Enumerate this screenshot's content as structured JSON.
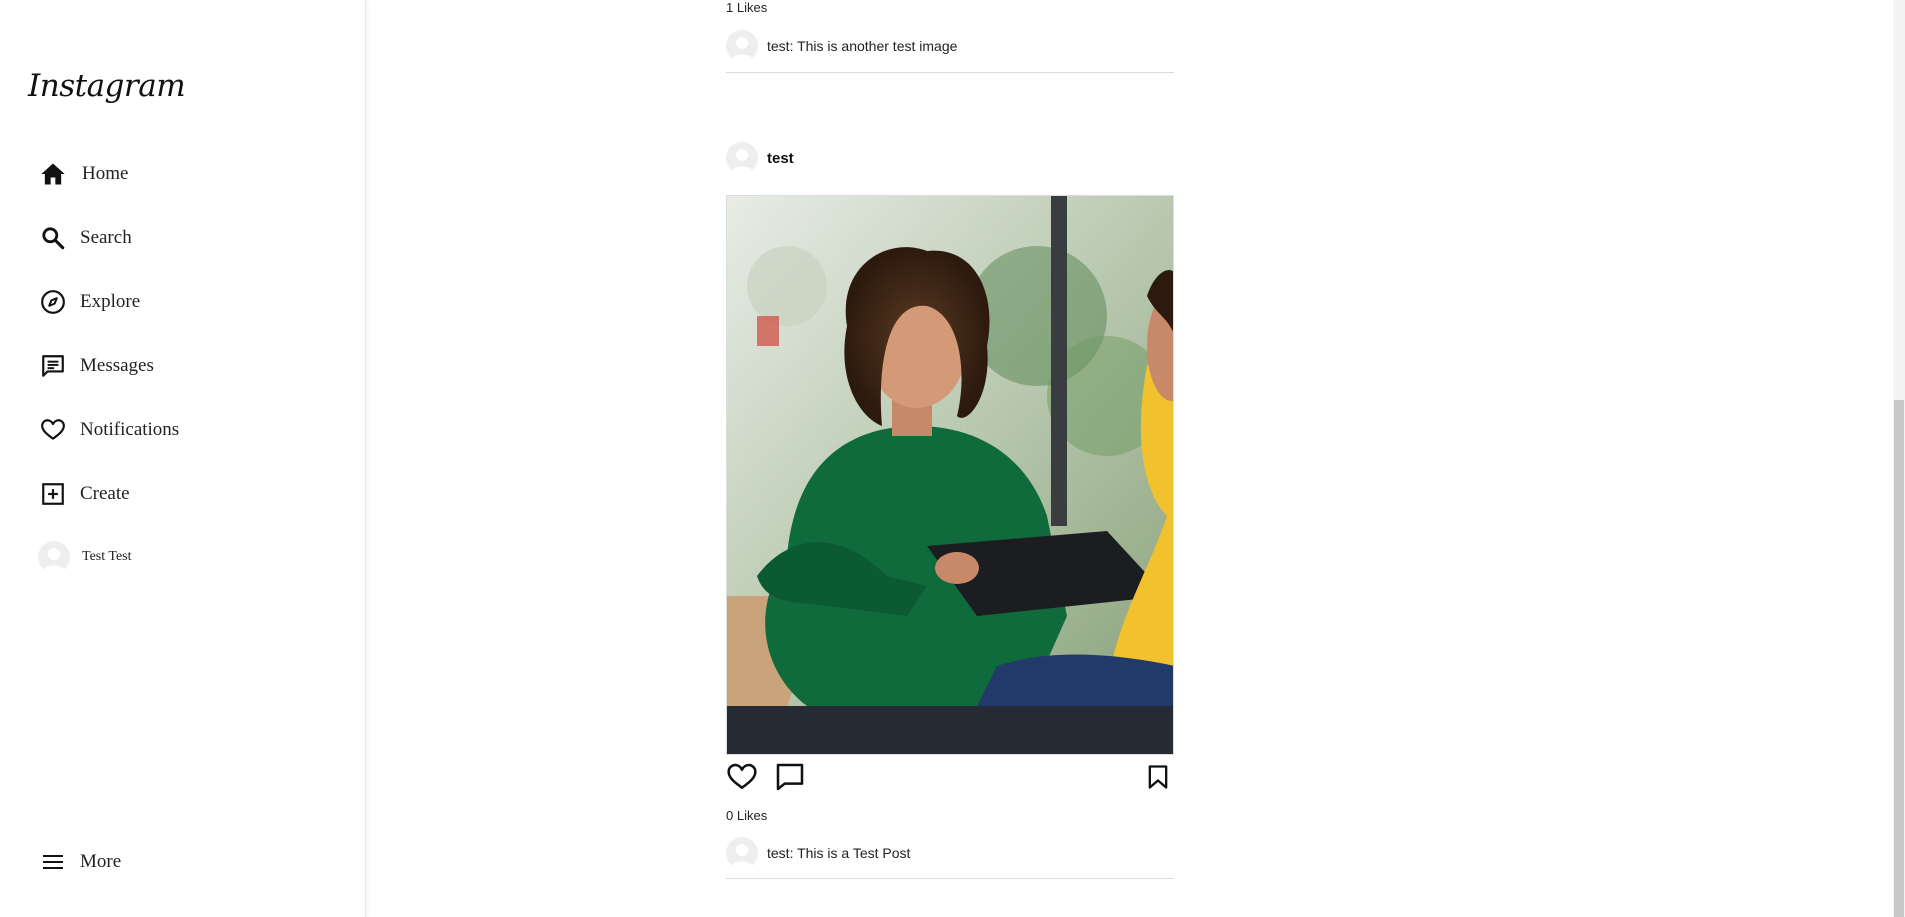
{
  "app": {
    "logo": "Instagram"
  },
  "sidebar": {
    "items": [
      {
        "label": "Home",
        "icon": "home-icon"
      },
      {
        "label": "Search",
        "icon": "search-icon"
      },
      {
        "label": "Explore",
        "icon": "compass-icon"
      },
      {
        "label": "Messages",
        "icon": "message-icon"
      },
      {
        "label": "Notifications",
        "icon": "heart-icon"
      },
      {
        "label": "Create",
        "icon": "plus-square-icon"
      }
    ],
    "profile": {
      "label": "Test Test",
      "icon": "avatar"
    },
    "more": {
      "label": "More",
      "icon": "menu-icon"
    }
  },
  "feed": {
    "prev_post": {
      "likes": "1 Likes",
      "caption": "test: This is another test image"
    },
    "post": {
      "username": "test",
      "likes": "0 Likes",
      "caption": "test: This is a Test Post"
    }
  },
  "colors": {
    "photo_sweater": "#0f6a3c",
    "photo_bar": "#262a34",
    "photo_yellow": "#f2c12e"
  }
}
